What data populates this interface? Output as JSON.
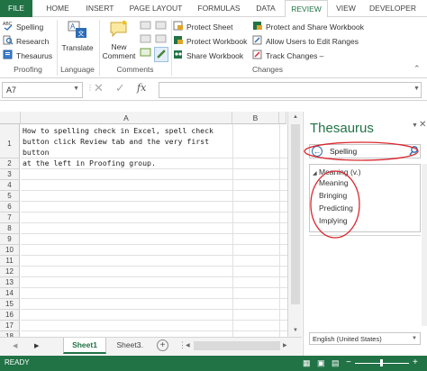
{
  "tabs": [
    {
      "label": "FILE"
    },
    {
      "label": "HOME"
    },
    {
      "label": "INSERT"
    },
    {
      "label": "PAGE LAYOUT"
    },
    {
      "label": "FORMULAS"
    },
    {
      "label": "DATA"
    },
    {
      "label": "REVIEW"
    },
    {
      "label": "VIEW"
    },
    {
      "label": "DEVELOPER"
    }
  ],
  "ribbon": {
    "proofing": {
      "label": "Proofing",
      "spelling": "Spelling",
      "research": "Research",
      "thesaurus": "Thesaurus"
    },
    "language": {
      "label": "Language",
      "translate": "Translate"
    },
    "comments": {
      "label": "Comments",
      "new_comment_line1": "New",
      "new_comment_line2": "Comment"
    },
    "changes": {
      "label": "Changes",
      "protect_sheet": "Protect Sheet",
      "protect_workbook": "Protect Workbook",
      "share_workbook": "Share Workbook",
      "protect_share": "Protect and Share Workbook",
      "allow_users": "Allow Users to Edit Ranges",
      "track_changes": "Track Changes –"
    }
  },
  "formula_bar": {
    "name_box": "A7",
    "fx": "fx"
  },
  "grid": {
    "columns": [
      "A",
      "B"
    ],
    "rows": [
      "1",
      "2",
      "3",
      "4",
      "5",
      "6",
      "7",
      "8",
      "9",
      "10",
      "11",
      "12",
      "13",
      "14",
      "15",
      "16",
      "17",
      "18"
    ],
    "a1": "How to spelling check in Excel, spell check\nbutton click Review tab and the very first button\nat the left in Proofing group."
  },
  "sheets": {
    "active": "Sheet1",
    "other": "Sheet3",
    "ellipsis": "..."
  },
  "status": "READY",
  "thesaurus": {
    "title": "Thesaurus",
    "search_value": "Spelling",
    "heading": "Meaning (v.)",
    "items": [
      "Meaning",
      "Bringing",
      "Predicting",
      "Implying"
    ],
    "language": "English (United States)"
  },
  "colors": {
    "accent": "#217346",
    "annotation": "#d9272e"
  }
}
